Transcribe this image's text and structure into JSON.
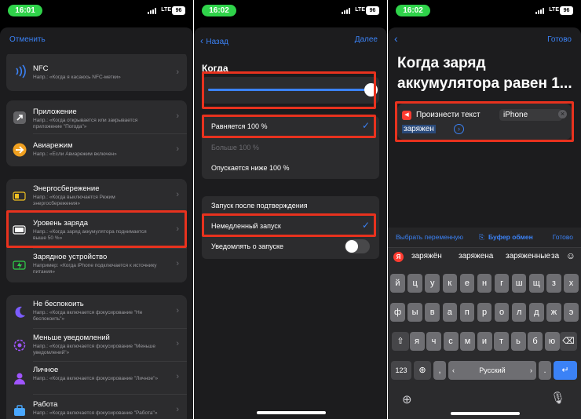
{
  "screen1": {
    "time": "16:01",
    "network": "LTE",
    "battery": "96",
    "cancel": "Отменить",
    "items": [
      {
        "title": "NFC",
        "subtitle": "Напр.: «Когда я касаюсь NFC-метки»",
        "icon": "nfc-icon"
      },
      {
        "title": "Приложение",
        "subtitle": "Напр.: «Когда открывается или закрывается приложение \"Погода\"»",
        "icon": "app-icon"
      },
      {
        "title": "Авиарежим",
        "subtitle": "Напр.: «Если Авиарежим включен»",
        "icon": "airplane-icon"
      },
      {
        "title": "Энергосбережение",
        "subtitle": "Напр.: «Когда выключается Режим энергосбережения»",
        "icon": "low-power-icon"
      },
      {
        "title": "Уровень заряда",
        "subtitle": "Напр.: «Когда заряд аккумулятора поднимается выше 50 %»",
        "icon": "battery-icon"
      },
      {
        "title": "Зарядное устройство",
        "subtitle": "Например: «Когда iPhone подключается к источнику питания»",
        "icon": "charger-icon"
      },
      {
        "title": "Не беспокоить",
        "subtitle": "Напр.: «Когда включается фокусирование \"Не беспокоить\"»",
        "icon": "moon-icon"
      },
      {
        "title": "Меньше уведомлений",
        "subtitle": "Напр.: «Когда включается фокусирование \"Меньше уведомлений\"»",
        "icon": "reduce-notifications-icon"
      },
      {
        "title": "Личное",
        "subtitle": "Напр.: «Когда включается фокусирование \"Личное\"»",
        "icon": "person-icon"
      },
      {
        "title": "Работа",
        "subtitle": "Напр.: «Когда включается фокусирование \"Работа\"»",
        "icon": "work-icon"
      }
    ]
  },
  "screen2": {
    "time": "16:02",
    "network": "LTE",
    "battery": "96",
    "back": "Назад",
    "next": "Далее",
    "section": "Когда",
    "slider_value": 1.0,
    "options": [
      "Равняется 100 %",
      "Больше 100 %",
      "Опускается ниже 100 %"
    ],
    "run": [
      "Запуск после подтверждения",
      "Немедленный запуск",
      "Уведомлять о запуске"
    ],
    "notify_toggle": false
  },
  "screen3": {
    "time": "16:02",
    "network": "LTE",
    "battery": "96",
    "done": "Готово",
    "title": "Когда заряд аккумулятора равен 1...",
    "action_label": "Произнести текст",
    "action_param": "iPhone",
    "action_text": "заряжен",
    "kb_bar": {
      "variable": "Выбрать переменную",
      "clipboard": "Буфер обмен",
      "done": "Готово"
    },
    "predictions": [
      "заряжён",
      "заряжена",
      "заряженные",
      "за"
    ],
    "rows": [
      [
        "й",
        "ц",
        "у",
        "к",
        "е",
        "н",
        "г",
        "ш",
        "щ",
        "з",
        "х"
      ],
      [
        "ф",
        "ы",
        "в",
        "а",
        "п",
        "р",
        "о",
        "л",
        "д",
        "ж",
        "э"
      ],
      [
        "я",
        "ч",
        "с",
        "м",
        "и",
        "т",
        "ь",
        "б",
        "ю"
      ]
    ],
    "key_123": "123",
    "comma": ",",
    "space": "Русский",
    "period": "."
  }
}
